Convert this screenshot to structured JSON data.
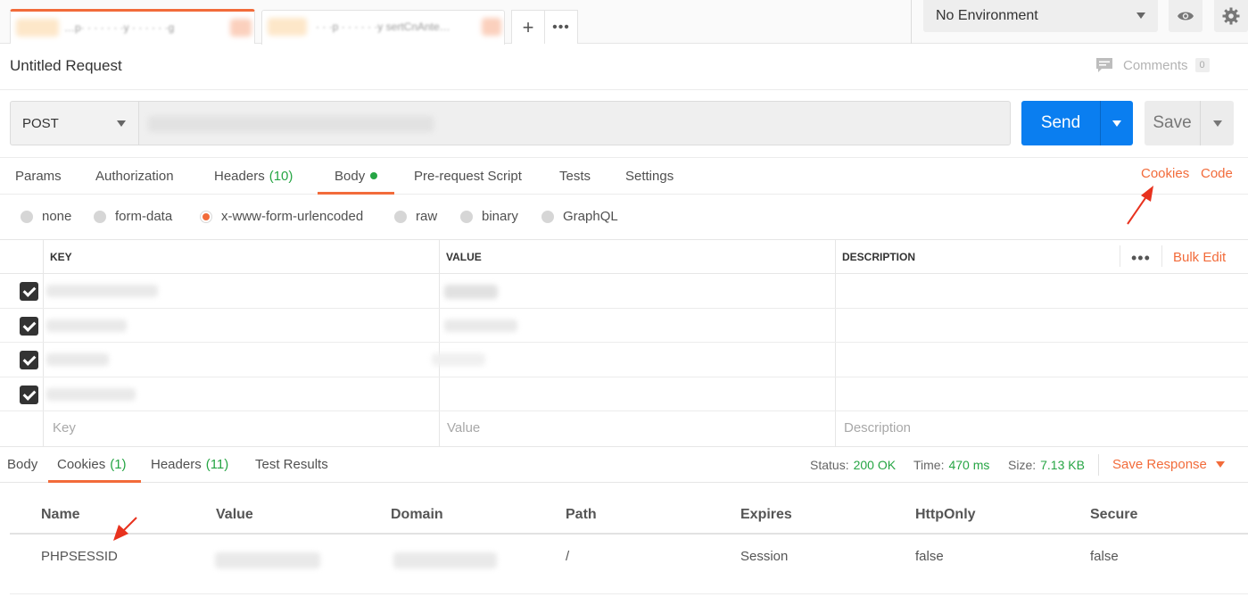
{
  "environment": {
    "selected": "No Environment"
  },
  "request": {
    "title": "Untitled Request",
    "comments_label": "Comments",
    "comments_count": "0",
    "method": "POST",
    "send_label": "Send",
    "save_label": "Save"
  },
  "request_tabs": [
    {
      "label": "Params"
    },
    {
      "label": "Authorization"
    },
    {
      "label": "Headers",
      "count": "(10)"
    },
    {
      "label": "Body"
    },
    {
      "label": "Pre-request Script"
    },
    {
      "label": "Tests"
    },
    {
      "label": "Settings"
    }
  ],
  "links": {
    "cookies": "Cookies",
    "code": "Code"
  },
  "body_types": [
    "none",
    "form-data",
    "x-www-form-urlencoded",
    "raw",
    "binary",
    "GraphQL"
  ],
  "kv_table": {
    "headers": [
      "KEY",
      "VALUE",
      "DESCRIPTION"
    ],
    "bulk_edit": "Bulk Edit",
    "placeholders": {
      "key": "Key",
      "value": "Value",
      "description": "Description"
    }
  },
  "response_tabs": [
    {
      "label": "Body"
    },
    {
      "label": "Cookies",
      "count": "(1)"
    },
    {
      "label": "Headers",
      "count": "(11)"
    },
    {
      "label": "Test Results"
    }
  ],
  "response_status": {
    "status_label": "Status:",
    "status": "200 OK",
    "time_label": "Time:",
    "time": "470 ms",
    "size_label": "Size:",
    "size": "7.13 KB",
    "save_response": "Save Response"
  },
  "cookies_table": {
    "headers": [
      "Name",
      "Value",
      "Domain",
      "Path",
      "Expires",
      "HttpOnly",
      "Secure"
    ],
    "rows": [
      {
        "name": "PHPSESSID",
        "path": "/",
        "expires": "Session",
        "httponly": "false",
        "secure": "false"
      }
    ]
  },
  "colors": {
    "accent": "#f26b3a",
    "send": "#0a7ef0",
    "success": "#26a544",
    "annotation_arrow": "#e8321e"
  }
}
